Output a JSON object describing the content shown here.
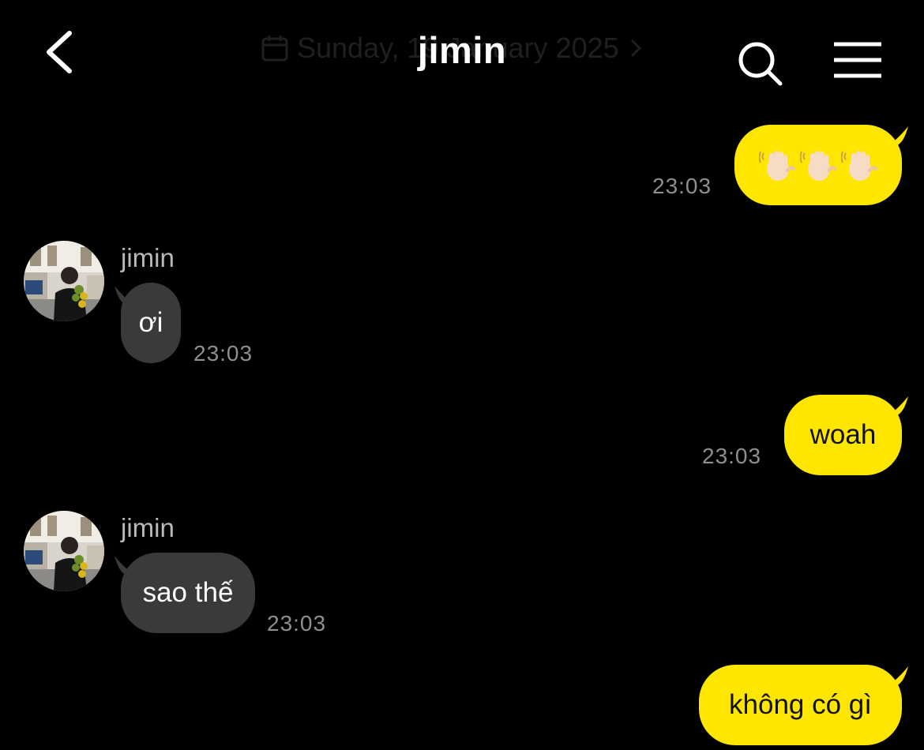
{
  "header": {
    "title": "jimin",
    "date_ghost": "Sunday, 19 January 2025",
    "icons": {
      "back": "chevron-left-icon",
      "search": "search-icon",
      "menu": "hamburger-menu-icon",
      "calendar": "calendar-icon"
    }
  },
  "colors": {
    "background": "#000000",
    "outgoing_bubble": "#ffe600",
    "incoming_bubble": "#3a3a3c",
    "timestamp": "#8e8e93",
    "sender_name": "#b9b9bd"
  },
  "messages": [
    {
      "direction": "out",
      "content_icons": [
        "waving-hand-icon",
        "waving-hand-icon",
        "waving-hand-icon"
      ],
      "time": "23:03"
    },
    {
      "direction": "in",
      "sender": "jimin",
      "text": "ơi",
      "time": "23:03"
    },
    {
      "direction": "out",
      "text": "woah",
      "time": "23:03"
    },
    {
      "direction": "in",
      "sender": "jimin",
      "text": "sao thế",
      "time": "23:03"
    },
    {
      "direction": "out",
      "text": "không có gì"
    }
  ]
}
